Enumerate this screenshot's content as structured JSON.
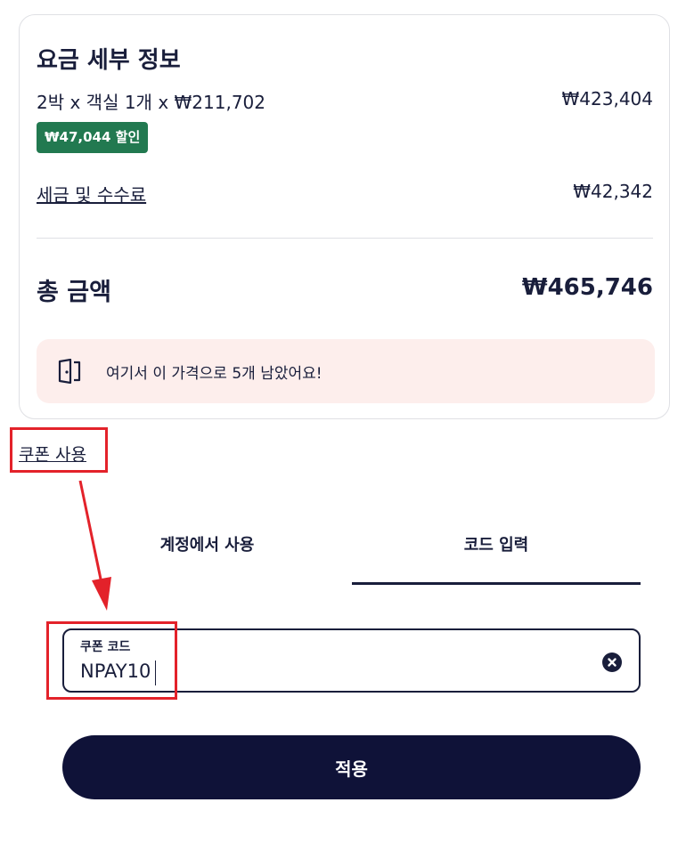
{
  "price_details": {
    "title": "요금 세부 정보",
    "room_line": {
      "label": "2박 x 객실 1개 x ₩211,702",
      "value": "₩423,404"
    },
    "discount_badge": "₩47,044 할인",
    "tax_line": {
      "label": "세금 및 수수료",
      "value": "₩42,342"
    },
    "total": {
      "label": "총 금액",
      "value": "₩465,746"
    },
    "notice": {
      "icon": "door-icon",
      "text": "여기서 이 가격으로 5개 남았어요!"
    }
  },
  "coupon": {
    "link_label": "쿠폰 사용",
    "tabs": [
      {
        "label": "계정에서 사용",
        "selected": false
      },
      {
        "label": "코드 입력",
        "selected": true
      }
    ],
    "input": {
      "label": "쿠폰 코드",
      "value": "NPAY10",
      "clear_icon": "clear-circle-icon"
    },
    "apply_label": "적용"
  },
  "colors": {
    "text": "#191e3b",
    "discount_bg": "#227950",
    "notice_bg": "#fdeeec",
    "button_bg": "#0f1238",
    "highlight": "#e3222a"
  }
}
